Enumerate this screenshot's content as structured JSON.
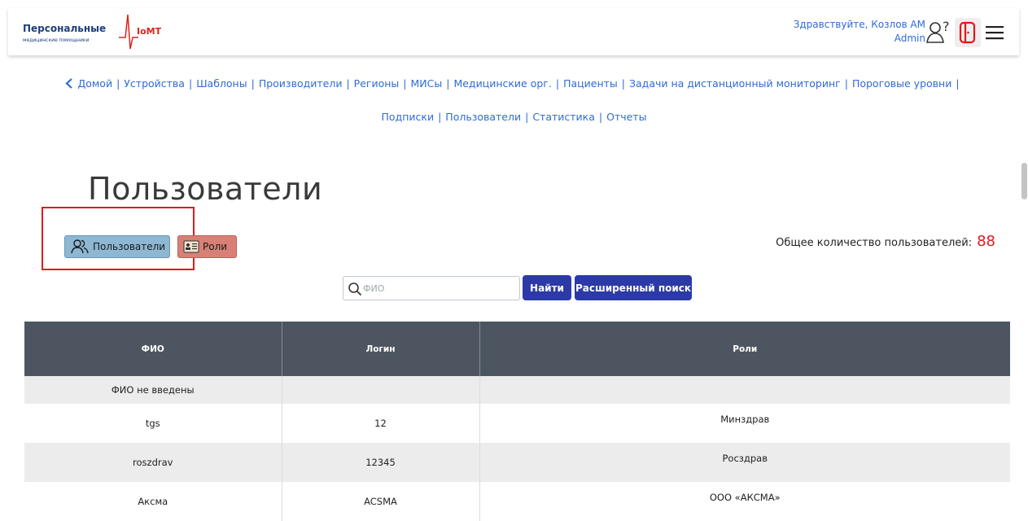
{
  "header": {
    "logo_main": "Персональные",
    "logo_sub": "медицинские помощники",
    "logo_iomt": "IoMT",
    "greeting": "Здравствуйте, Козлов АМ",
    "role": "Admin",
    "icons": [
      "help-icon",
      "logout-icon",
      "menu-icon"
    ]
  },
  "nav": {
    "back_icon": "chevron-left-icon",
    "line1": [
      "Домой",
      "Устройства",
      "Шаблоны",
      "Производители",
      "Регионы",
      "МИСы",
      "Медицинские орг.",
      "Пациенты",
      "Задачи на дистанционный мониторинг",
      "Пороговые уровни"
    ],
    "line2": [
      "Подписки",
      "Пользователи",
      "Статистика",
      "Отчеты"
    ]
  },
  "page": {
    "title": "Пользователи",
    "tab_users": "Пользователи",
    "tab_roles": "Роли",
    "total_label": "Общее количество пользователей:",
    "total_value": "88"
  },
  "search": {
    "placeholder": "ФИО",
    "find_label": "Найти",
    "advanced_label": "Расширенный поиск"
  },
  "table": {
    "headers": [
      "ФИО",
      "Логин",
      "Роли"
    ],
    "rows": [
      [
        "ФИО не введены",
        "",
        ""
      ],
      [
        "tgs",
        "12",
        "Минздрав"
      ],
      [
        "roszdrav",
        "12345",
        "Росздрав"
      ],
      [
        "Аксма",
        "ACSMA",
        "ООО «АКСМА»"
      ]
    ]
  },
  "colors": {
    "accent": "#2c3aa8",
    "link": "#2f6bd6",
    "highlight": "#e0191c",
    "table_header": "#4d5660"
  }
}
